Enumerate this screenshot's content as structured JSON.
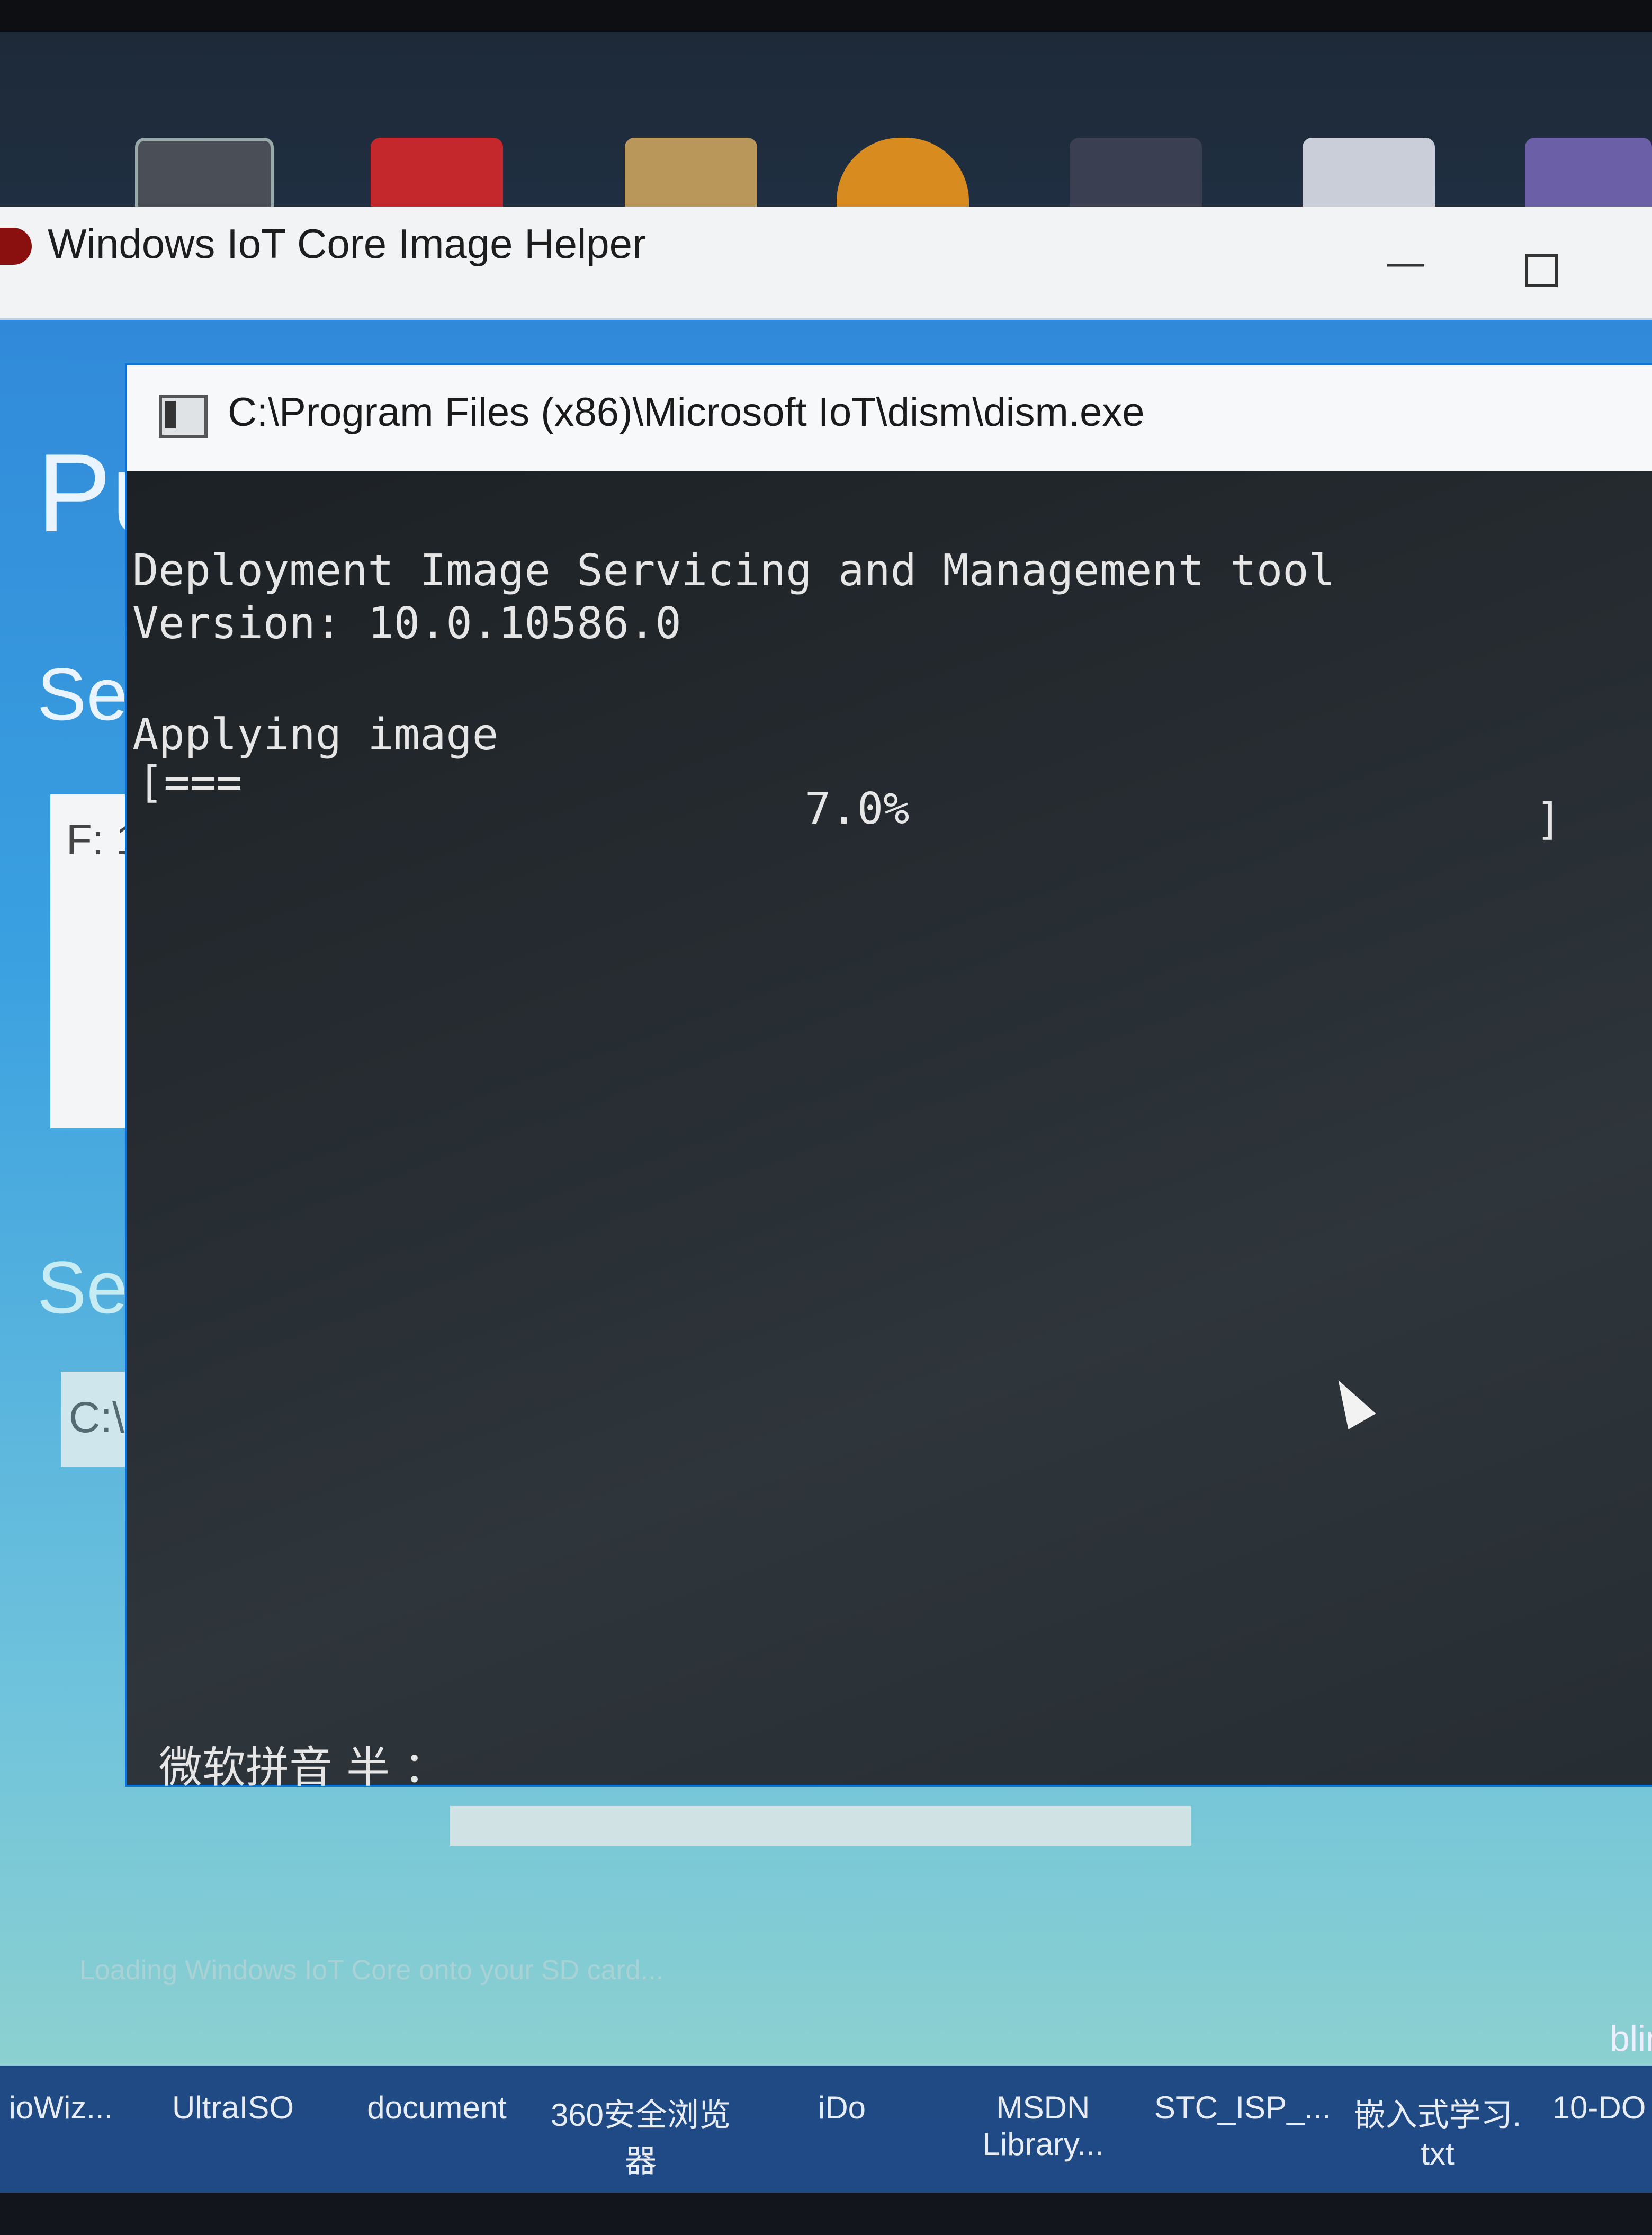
{
  "app": {
    "title": "Windows IoT Core Image Helper",
    "left_fragments": {
      "heading": "Pu",
      "section1": "Sel",
      "drive": "F: 1",
      "section2": "Sel",
      "path": "C:\\P"
    },
    "loading_text": "Loading Windows IoT Core onto your SD card...",
    "right_edge_text": "blir"
  },
  "console": {
    "title": "C:\\Program Files (x86)\\Microsoft IoT\\dism\\dism.exe",
    "lines": [
      "Deployment Image Servicing and Management tool",
      "Version: 10.0.10586.0",
      "Applying image"
    ],
    "progress_bar": "[===",
    "progress_percent": "7.0%",
    "progress_end": "]",
    "ime_status": "微软拼音 半 ："
  },
  "desktop_labels": [
    "ioWiz...",
    "UltraISO",
    "document",
    "360安全浏览\n器",
    "iDo",
    "MSDN\nLibrary...",
    "STC_ISP_...",
    "嵌入式学习.\ntxt",
    "10-DO"
  ]
}
